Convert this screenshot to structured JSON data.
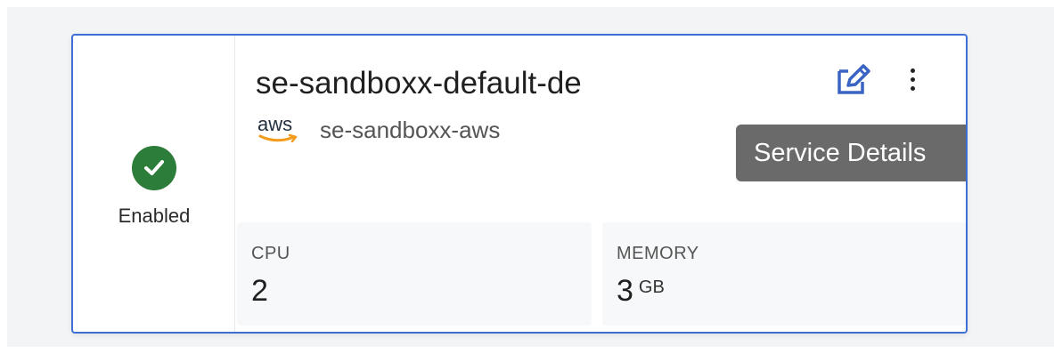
{
  "service": {
    "name": "se-sandboxx-default-de",
    "status": "Enabled",
    "status_color": "#2c7d3a",
    "provider_logo": "aws",
    "account": "se-sandboxx-aws"
  },
  "actions": {
    "edit_icon": "edit-icon",
    "more_icon": "more-vertical-icon",
    "tooltip": "Service Details"
  },
  "metrics": {
    "cpu": {
      "label": "CPU",
      "value": "2"
    },
    "memory": {
      "label": "MEMORY",
      "value": "3",
      "unit": "GB"
    }
  },
  "colors": {
    "accent_border": "#3d6fd6",
    "edit_icon": "#3a64c4",
    "aws_smile": "#f29b1d"
  }
}
